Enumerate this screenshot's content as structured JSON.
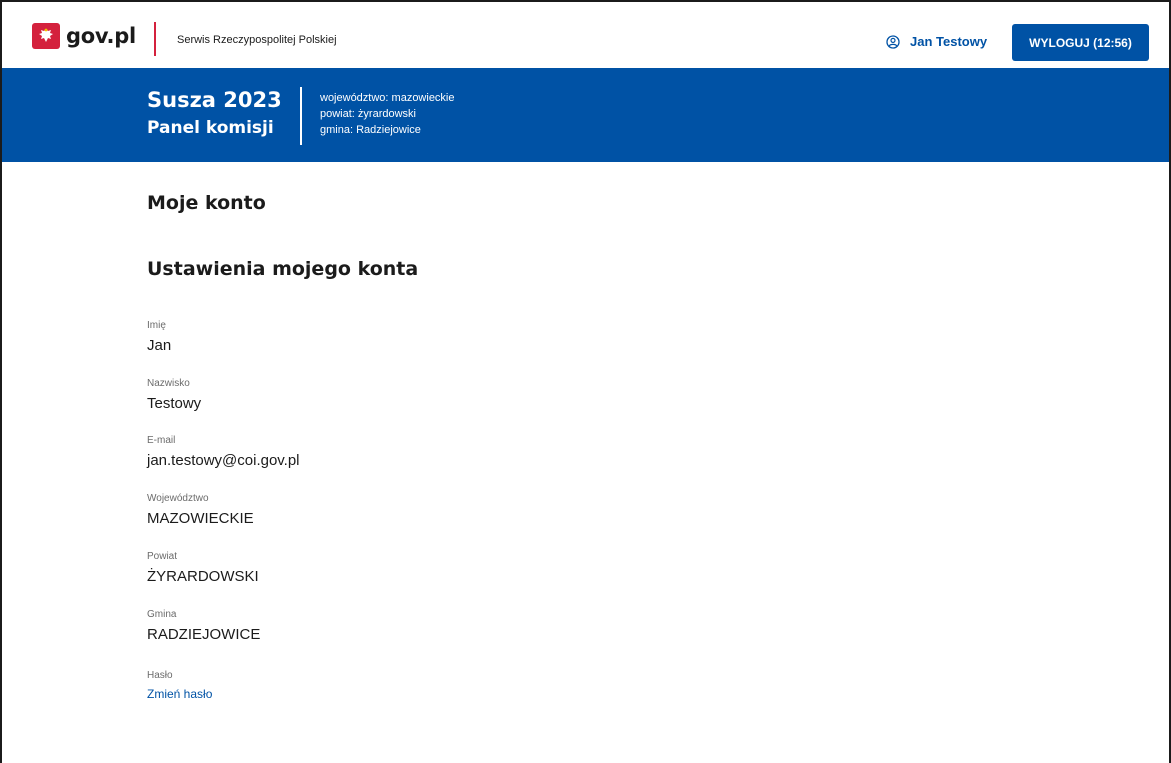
{
  "topbar": {
    "logo_text": "gov.pl",
    "service_name": "Serwis Rzeczypospolitej Polskiej",
    "user_name": "Jan Testowy",
    "logout_label": "WYLOGUJ (12:56)"
  },
  "header": {
    "title": "Susza 2023",
    "subtitle": "Panel komisji",
    "region": {
      "voivodeship": "województwo: mazowieckie",
      "county": "powiat: żyrardowski",
      "commune": "gmina: Radziejowice"
    }
  },
  "main": {
    "page_title": "Moje konto",
    "section_title": "Ustawienia mojego konta",
    "fields": [
      {
        "label": "Imię",
        "value": "Jan"
      },
      {
        "label": "Nazwisko",
        "value": "Testowy"
      },
      {
        "label": "E-mail",
        "value": "jan.testowy@coi.gov.pl"
      },
      {
        "label": "Województwo",
        "value": "MAZOWIECKIE"
      },
      {
        "label": "Powiat",
        "value": "ŻYRARDOWSKI"
      },
      {
        "label": "Gmina",
        "value": "RADZIEJOWICE"
      }
    ],
    "password": {
      "label": "Hasło",
      "link": "Zmień hasło"
    }
  },
  "colors": {
    "brand_blue": "#0052a5",
    "brand_red": "#d4213d"
  },
  "icons": {
    "emblem": "polish-eagle-icon",
    "user": "user-circle-icon"
  }
}
